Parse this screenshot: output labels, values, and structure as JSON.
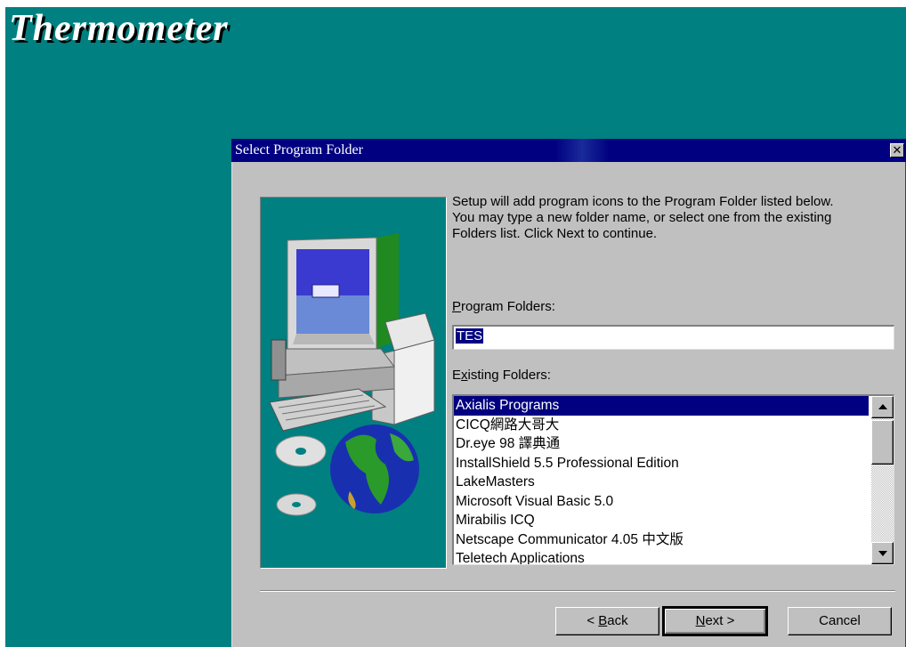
{
  "app": {
    "title": "Thermometer"
  },
  "dialog": {
    "title": "Select Program Folder",
    "close_glyph": "✕",
    "intro_lines": [
      "Setup will add program icons to the Program Folder listed below.",
      "You may type a new folder name, or select one from the existing",
      "Folders list.  Click Next to continue."
    ],
    "program_folders_label": {
      "mnemonic": "P",
      "rest": "rogram Folders:"
    },
    "program_folder_value": "TES",
    "existing_folders_label": {
      "pre": "E",
      "mnemonic": "x",
      "rest": "isting Folders:"
    },
    "folders": [
      "Axialis Programs",
      "CICQ網路大哥大",
      "Dr.eye 98 譯典通",
      "InstallShield 5.5 Professional Edition",
      "LakeMasters",
      "Microsoft Visual Basic 5.0",
      "Mirabilis ICQ",
      "Netscape Communicator 4.05 中文版",
      "Teletech Applications"
    ],
    "selected_folder_index": 0,
    "buttons": {
      "back": {
        "pre": "< ",
        "mnemonic": "B",
        "rest": "ack"
      },
      "next": {
        "mnemonic": "N",
        "rest": "ext >"
      },
      "cancel": "Cancel"
    }
  },
  "colors": {
    "desktop": "#008080",
    "titlebar": "#000080",
    "face": "#c0c0c0",
    "selection": "#000080"
  }
}
